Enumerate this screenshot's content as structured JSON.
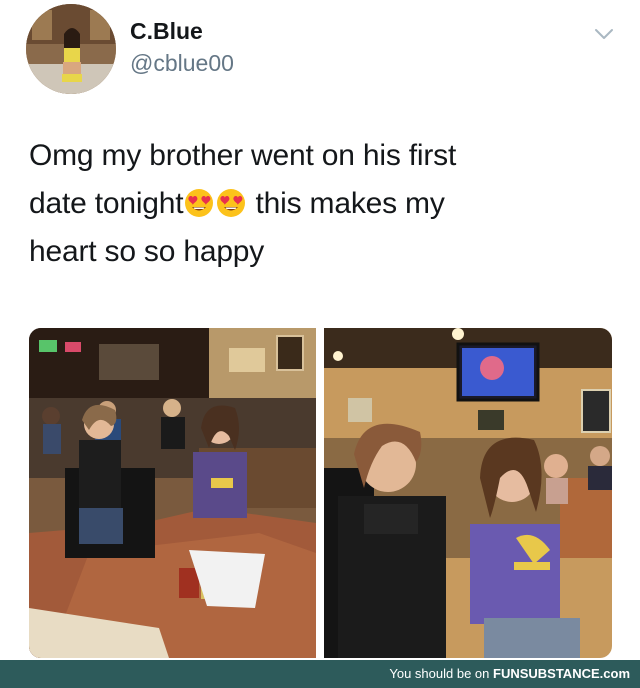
{
  "user": {
    "display_name": "C.Blue",
    "handle": "@cblue00"
  },
  "tweet": {
    "line1": "Omg my brother went on his first",
    "line2_before": "date tonight",
    "line2_after": " this makes my",
    "line3": "heart so so happy",
    "emoji_name": "smiling-face-with-heart-eyes"
  },
  "footer": {
    "prefix": "You should be on ",
    "brand": "FUNSUBSTANCE",
    "suffix": ".com"
  },
  "colors": {
    "text": "#14171a",
    "handle": "#657786",
    "footer_bg": "#2d5b5b"
  }
}
